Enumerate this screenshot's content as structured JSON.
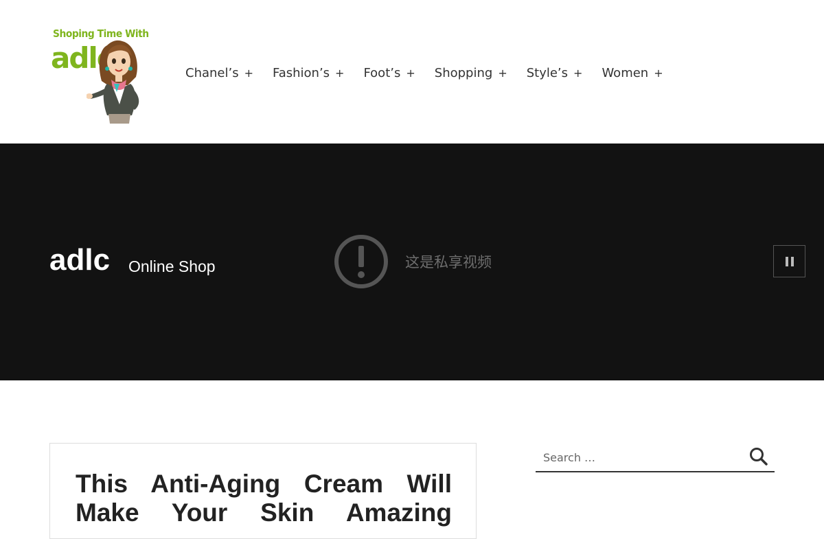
{
  "logo": {
    "tagline": "Shoping Time With",
    "word": "adlc"
  },
  "nav": {
    "items": [
      {
        "label": "Chanel’s",
        "expand": "+"
      },
      {
        "label": "Fashion’s",
        "expand": "+"
      },
      {
        "label": "Foot’s",
        "expand": "+"
      },
      {
        "label": "Shopping",
        "expand": "+"
      },
      {
        "label": "Style’s",
        "expand": "+"
      },
      {
        "label": "Women",
        "expand": "+"
      }
    ]
  },
  "hero": {
    "title": "adlc",
    "subtitle": "Online Shop",
    "video_notice": "这是私享视频"
  },
  "post": {
    "title": "This Anti-Aging Cream Will Make Your Skin Amazing"
  },
  "search": {
    "placeholder": "Search …"
  },
  "colors": {
    "brand_green": "#7fb51e",
    "hero_bg": "#121212",
    "text": "#222222"
  }
}
